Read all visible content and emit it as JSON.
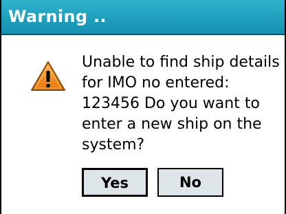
{
  "dialog": {
    "title": "Warning ..",
    "icon": "warning-icon",
    "message": "Unable to find ship details\nfor IMO no entered:\n123456 Do you want to\nenter a new ship on the\nsystem?",
    "buttons": {
      "yes_label": "Yes",
      "no_label": "No"
    }
  },
  "colors": {
    "titlebar": "#1e9fbd",
    "title_text": "#ffffff",
    "button_face": "#dde5e8",
    "icon_fill": "#f08a1c"
  }
}
